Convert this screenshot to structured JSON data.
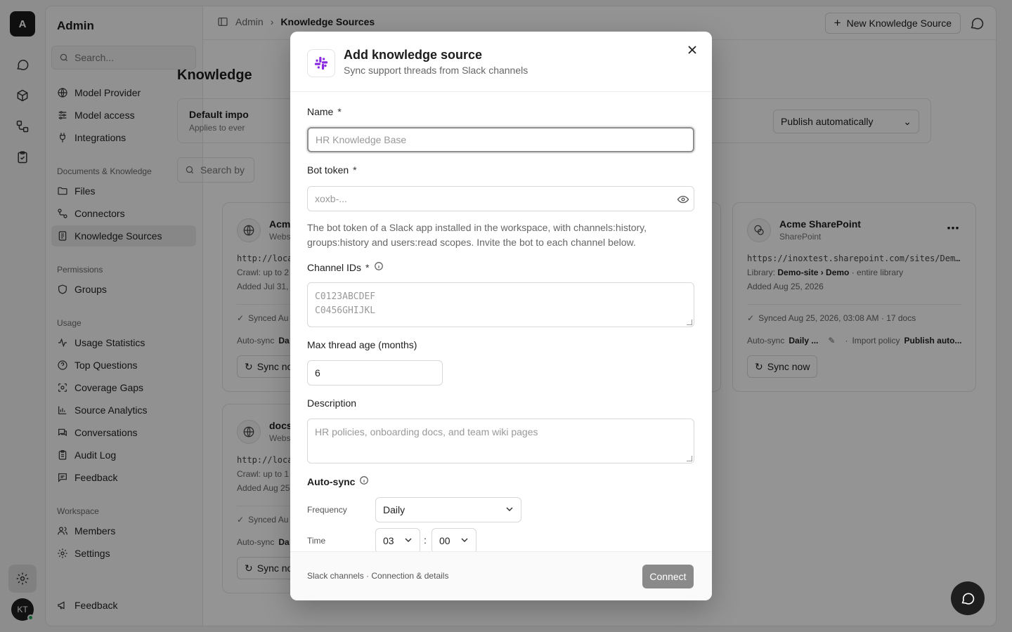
{
  "rail": {
    "logo_letter": "A",
    "user_initials": "KT"
  },
  "sidebar": {
    "title": "Admin",
    "search_placeholder": "Search...",
    "items_top": [
      {
        "label": "Model Provider",
        "icon": "globe-icon"
      },
      {
        "label": "Model access",
        "icon": "sliders-icon"
      },
      {
        "label": "Integrations",
        "icon": "plug-icon"
      }
    ],
    "section_docs": "Documents & Knowledge",
    "items_docs": [
      {
        "label": "Files",
        "icon": "folder-icon"
      },
      {
        "label": "Connectors",
        "icon": "connector-icon"
      },
      {
        "label": "Knowledge Sources",
        "icon": "book-icon",
        "active": true
      }
    ],
    "section_permissions": "Permissions",
    "items_permissions": [
      {
        "label": "Groups",
        "icon": "shield-icon"
      }
    ],
    "section_usage": "Usage",
    "items_usage": [
      {
        "label": "Usage Statistics",
        "icon": "activity-icon"
      },
      {
        "label": "Top Questions",
        "icon": "help-circle-icon"
      },
      {
        "label": "Coverage Gaps",
        "icon": "scan-icon"
      },
      {
        "label": "Source Analytics",
        "icon": "bar-chart-icon"
      },
      {
        "label": "Conversations",
        "icon": "messages-icon"
      },
      {
        "label": "Audit Log",
        "icon": "clipboard-icon"
      },
      {
        "label": "Feedback",
        "icon": "message-square-icon"
      }
    ],
    "section_workspace": "Workspace",
    "items_workspace": [
      {
        "label": "Members",
        "icon": "users-icon"
      },
      {
        "label": "Settings",
        "icon": "gear-icon"
      }
    ],
    "bottom_item": {
      "label": "Feedback",
      "icon": "megaphone-icon"
    }
  },
  "topbar": {
    "crumb_root": "Admin",
    "crumb_current": "Knowledge Sources",
    "new_button": "New Knowledge Source"
  },
  "main": {
    "page_title": "Knowledge",
    "policy": {
      "title": "Default impo",
      "subtitle": "Applies to ever",
      "select_value": "Publish automatically"
    },
    "search_placeholder": "Search by",
    "cards": [
      {
        "name": "Acm",
        "type": "Webs",
        "url": "http://loca",
        "line1": "Crawl: up to 2",
        "line2": "Added Jul 31,",
        "sync": "Synced Au",
        "auto_label": "Auto-sync",
        "auto_value": "Da",
        "sync_button": "Sync no"
      },
      {
        "name": "docs",
        "type": "Webs",
        "url": "http://loca",
        "line1": "Crawl: up to 1",
        "line2": "Added Aug 25",
        "sync": "Synced Au",
        "auto_label": "Auto-sync",
        "auto_value": "Da",
        "sync_button": "Sync no"
      },
      {
        "name": "Acme SharePoint",
        "type": "SharePoint",
        "url": "https://inoxtest.sharepoint.com/sites/Demo-site",
        "line1_prefix": "Library: ",
        "line1_value": "Demo-site › Demo",
        "line1_suffix": " · entire library",
        "line2": "Added Aug 25, 2026",
        "sync": "Synced Aug 25, 2026, 03:08 AM · 17 docs",
        "auto_label": "Auto-sync",
        "auto_value": "Daily ...",
        "policy_label": "Import policy",
        "policy_value": "Publish auto...",
        "sync_button": "Sync now"
      }
    ]
  },
  "modal": {
    "title": "Add knowledge source",
    "subtitle": "Sync support threads from Slack channels",
    "name_label": "Name",
    "required_mark": "*",
    "name_placeholder": "HR Knowledge Base",
    "token_label": "Bot token",
    "token_placeholder": "xoxb-...",
    "token_help": "The bot token of a Slack app installed in the workspace, with channels:history, groups:history and users:read scopes. Invite the bot to each channel below.",
    "channels_label": "Channel IDs",
    "channels_placeholder_1": "C0123ABCDEF",
    "channels_placeholder_2": "C0456GHIJKL",
    "age_label": "Max thread age (months)",
    "age_value": "6",
    "desc_label": "Description",
    "desc_placeholder": "HR policies, onboarding docs, and team wiki pages",
    "autosync_label": "Auto-sync",
    "frequency_label": "Frequency",
    "frequency_value": "Daily",
    "time_label": "Time",
    "time_hour": "03",
    "time_sep": ":",
    "time_minute": "00",
    "footer_info": "Slack channels · Connection & details",
    "connect_button": "Connect"
  },
  "colors": {
    "overlay": "#000000",
    "slack_purple": "#8a2be2",
    "connect_disabled": "#8a8a8a"
  }
}
